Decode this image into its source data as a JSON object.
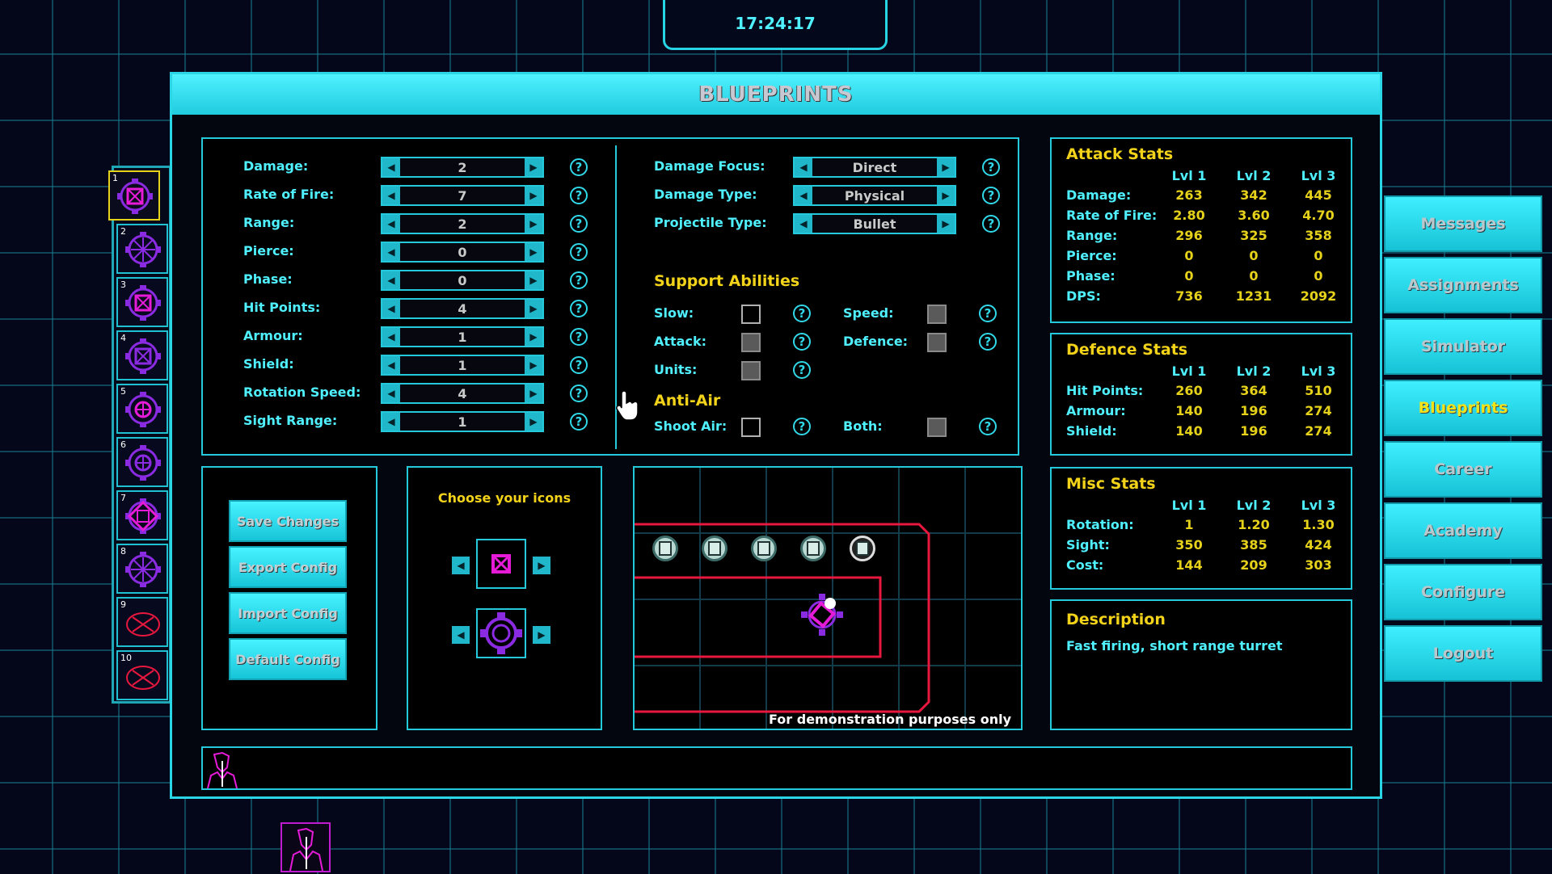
{
  "clock": "17:24:17",
  "title": "BLUEPRINTS",
  "slots": [
    "1",
    "2",
    "3",
    "4",
    "5",
    "6",
    "7",
    "8",
    "9",
    "10"
  ],
  "left_stats": [
    {
      "label": "Damage:",
      "value": "2"
    },
    {
      "label": "Rate of Fire:",
      "value": "7"
    },
    {
      "label": "Range:",
      "value": "2"
    },
    {
      "label": "Pierce:",
      "value": "0"
    },
    {
      "label": "Phase:",
      "value": "0"
    },
    {
      "label": "Hit Points:",
      "value": "4"
    },
    {
      "label": "Armour:",
      "value": "1"
    },
    {
      "label": "Shield:",
      "value": "1"
    },
    {
      "label": "Rotation Speed:",
      "value": "4"
    },
    {
      "label": "Sight Range:",
      "value": "1"
    }
  ],
  "right_settings": [
    {
      "label": "Damage Focus:",
      "value": "Direct"
    },
    {
      "label": "Damage Type:",
      "value": "Physical"
    },
    {
      "label": "Projectile Type:",
      "value": "Bullet"
    }
  ],
  "help_glyph": "?",
  "support": {
    "title": "Support Abilities",
    "slow": "Slow:",
    "speed": "Speed:",
    "attack": "Attack:",
    "defence": "Defence:",
    "units": "Units:"
  },
  "antiair": {
    "title": "Anti-Air",
    "shoot_air": "Shoot Air:",
    "both": "Both:"
  },
  "attack_stats": {
    "title": "Attack Stats",
    "cols": [
      "Lvl 1",
      "Lvl 2",
      "Lvl 3"
    ],
    "rows": [
      {
        "label": "Damage:",
        "v": [
          "263",
          "342",
          "445"
        ]
      },
      {
        "label": "Rate of Fire:",
        "v": [
          "2.80",
          "3.60",
          "4.70"
        ]
      },
      {
        "label": "Range:",
        "v": [
          "296",
          "325",
          "358"
        ]
      },
      {
        "label": "Pierce:",
        "v": [
          "0",
          "0",
          "0"
        ]
      },
      {
        "label": "Phase:",
        "v": [
          "0",
          "0",
          "0"
        ]
      },
      {
        "label": "DPS:",
        "v": [
          "736",
          "1231",
          "2092"
        ]
      }
    ]
  },
  "defence_stats": {
    "title": "Defence Stats",
    "cols": [
      "Lvl 1",
      "Lvl 2",
      "Lvl 3"
    ],
    "rows": [
      {
        "label": "Hit Points:",
        "v": [
          "260",
          "364",
          "510"
        ]
      },
      {
        "label": "Armour:",
        "v": [
          "140",
          "196",
          "274"
        ]
      },
      {
        "label": "Shield:",
        "v": [
          "140",
          "196",
          "274"
        ]
      }
    ]
  },
  "misc_stats": {
    "title": "Misc Stats",
    "cols": [
      "Lvl 1",
      "Lvl 2",
      "Lvl 3"
    ],
    "rows": [
      {
        "label": "Rotation:",
        "v": [
          "1",
          "1.20",
          "1.30"
        ]
      },
      {
        "label": "Sight:",
        "v": [
          "350",
          "385",
          "424"
        ]
      },
      {
        "label": "Cost:",
        "v": [
          "144",
          "209",
          "303"
        ]
      }
    ]
  },
  "description": {
    "title": "Description",
    "text": "Fast firing, short range turret"
  },
  "config_buttons": [
    "Save Changes",
    "Export Config",
    "Import Config",
    "Default Config"
  ],
  "icons_title": "Choose your icons",
  "demo_note": "For demonstration purposes only",
  "menu": [
    "Messages",
    "Assignments",
    "Simulator",
    "Blueprints",
    "Career",
    "Academy",
    "Configure",
    "Logout"
  ],
  "active_menu": "Blueprints",
  "colors": {
    "accent": "#24c9db",
    "highlight": "#f2d319",
    "turret": "#e61bd8",
    "path": "#e8173e"
  }
}
